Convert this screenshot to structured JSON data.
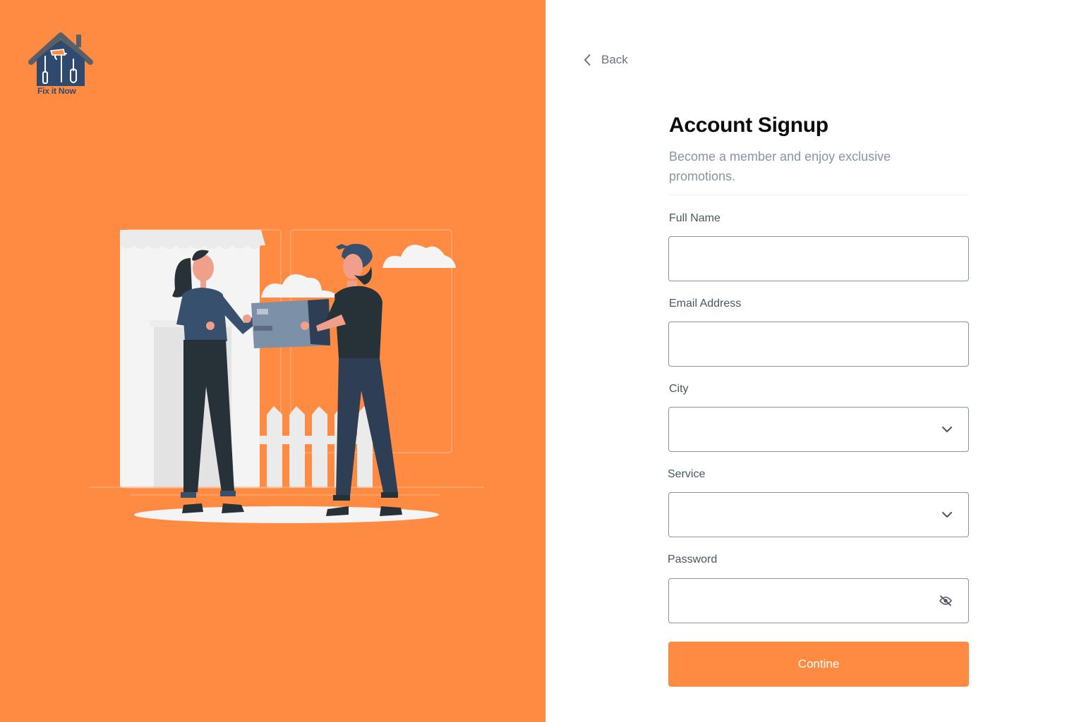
{
  "brand": {
    "logo_text": "Fix it Now",
    "accent_color": "#FF8A42",
    "logo_color": "#2E4A6E"
  },
  "nav": {
    "back_label": "Back",
    "back_icon": "chevron-left-icon"
  },
  "form": {
    "title": "Account Signup",
    "subtitle": "Become a member and enjoy exclusive promotions.",
    "fields": {
      "full_name": {
        "label": "Full Name",
        "value": "",
        "placeholder": ""
      },
      "email": {
        "label": "Email Address",
        "value": "",
        "placeholder": ""
      },
      "city": {
        "label": "City",
        "value": "",
        "icon": "chevron-down-icon"
      },
      "service": {
        "label": "Service",
        "value": "",
        "icon": "chevron-down-icon"
      },
      "password": {
        "label": "Password",
        "value": "",
        "placeholder": "",
        "icon": "eye-off-icon"
      }
    },
    "submit_label": "Contine"
  }
}
